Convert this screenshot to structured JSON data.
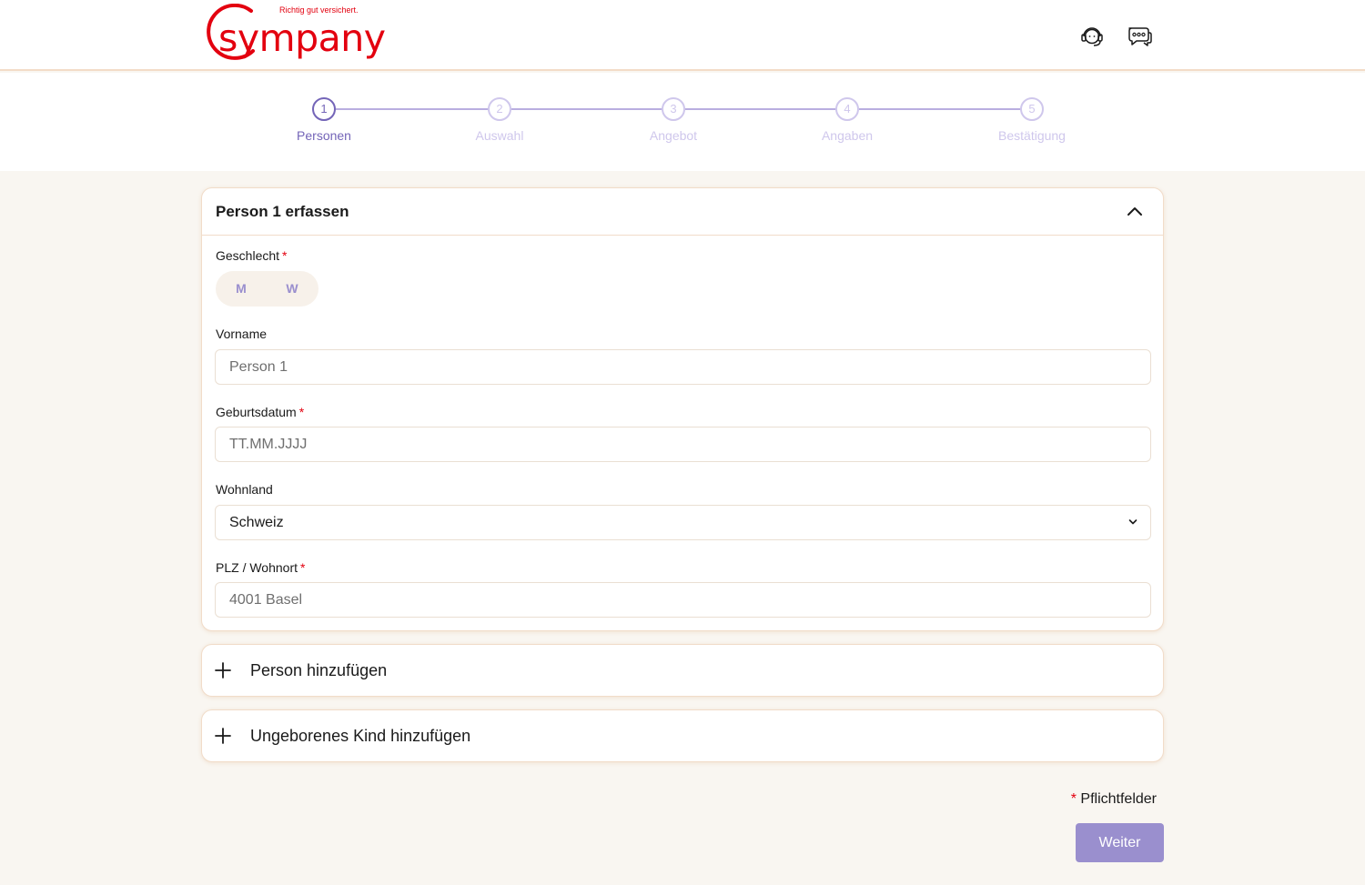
{
  "brand": {
    "name": "sympany",
    "tagline": "Richtig gut versichert.",
    "color": "#e3000f"
  },
  "header": {
    "icons": [
      "support-headset-icon",
      "chat-bubbles-icon"
    ]
  },
  "stepper": {
    "active_color": "#7465b8",
    "inactive_color": "#cfc7ec",
    "steps": [
      {
        "number": "1",
        "label": "Personen"
      },
      {
        "number": "2",
        "label": "Auswahl"
      },
      {
        "number": "3",
        "label": "Angebot"
      },
      {
        "number": "4",
        "label": "Angaben"
      },
      {
        "number": "5",
        "label": "Bestätigung"
      }
    ],
    "active_step": 1
  },
  "person_form": {
    "title": "Person 1 erfassen",
    "required_marker": "*",
    "gender": {
      "label": "Geschlecht",
      "options": [
        "M",
        "W"
      ]
    },
    "first_name": {
      "label": "Vorname",
      "placeholder": "Person 1",
      "value": ""
    },
    "birthdate": {
      "label": "Geburtsdatum",
      "placeholder": "TT.MM.JJJJ",
      "value": ""
    },
    "country": {
      "label": "Wohnland",
      "value": "Schweiz"
    },
    "zip_city": {
      "label": "PLZ / Wohnort",
      "placeholder": "4001 Basel",
      "value": ""
    }
  },
  "actions": {
    "add_person": "Person hinzufügen",
    "add_unborn_child": "Ungeborenes Kind hinzufügen",
    "required_note": "Pflichtfelder",
    "next": "Weiter",
    "button_color": "#9a8fce"
  }
}
